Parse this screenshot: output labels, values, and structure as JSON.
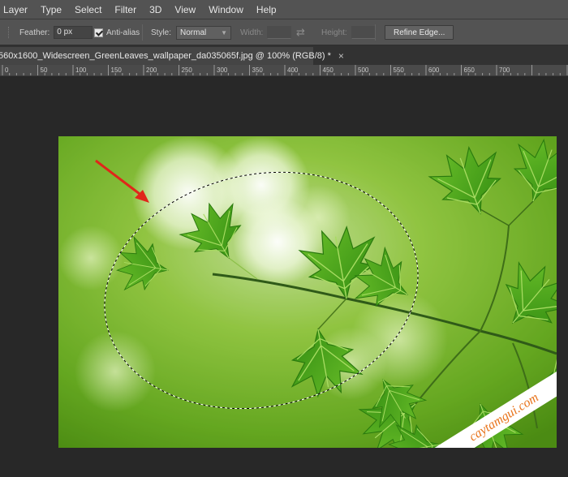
{
  "menubar": {
    "items": [
      "Layer",
      "Type",
      "Select",
      "Filter",
      "3D",
      "View",
      "Window",
      "Help"
    ]
  },
  "options": {
    "feather_label": "Feather:",
    "feather_value": "0 px",
    "antialias_label": "Anti-alias",
    "antialias_checked": true,
    "style_label": "Style:",
    "style_value": "Normal",
    "width_label": "Width:",
    "height_label": "Height:",
    "refine_edge_label": "Refine Edge..."
  },
  "document": {
    "tab_title": "560x1600_Widescreen_GreenLeaves_wallpaper_da035065f.jpg @ 100% (RGB/8) *",
    "close_symbol": "×"
  },
  "ruler": {
    "labels": [
      "0",
      "50",
      "100",
      "150",
      "200",
      "250",
      "300",
      "350",
      "400",
      "450",
      "500",
      "550",
      "600",
      "650",
      "700"
    ]
  },
  "image": {
    "watermark_text": "caytamgui.com"
  },
  "colors": {
    "panel": "#535353",
    "workspace": "#282828",
    "leaf_green": "#3e9e1c",
    "background_green": "#8cc43c",
    "arrow": "#e0261a",
    "watermark": "#e8731a"
  }
}
